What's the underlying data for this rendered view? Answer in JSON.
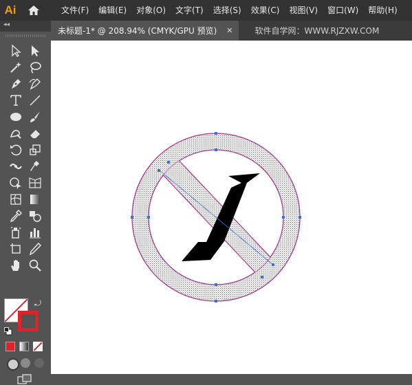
{
  "app": {
    "logo": "Ai"
  },
  "menu": [
    "文件(F)",
    "编辑(E)",
    "对象(O)",
    "文字(T)",
    "选择(S)",
    "效果(C)",
    "视图(V)",
    "窗口(W)",
    "帮助(H)"
  ],
  "tab": {
    "title": "未标题-1* @ 208.94% (CMYK/GPU 预览)",
    "close": "✕"
  },
  "watermark": "软件自学网：WWW.RJZXW.COM",
  "panel": {
    "collapse": "◂◂"
  },
  "tools": [
    [
      "selection-tool",
      "direct-selection-tool"
    ],
    [
      "magic-wand-tool",
      "lasso-tool"
    ],
    [
      "pen-tool",
      "curvature-tool"
    ],
    [
      "type-tool",
      "line-segment-tool"
    ],
    [
      "ellipse-tool",
      "paintbrush-tool"
    ],
    [
      "shaper-tool",
      "eraser-tool"
    ],
    [
      "rotate-tool",
      "scale-tool"
    ],
    [
      "width-tool",
      "puppet-warp-tool"
    ],
    [
      "shape-builder-tool",
      "perspective-grid-tool"
    ],
    [
      "mesh-tool",
      "gradient-tool"
    ],
    [
      "eyedropper-tool",
      "blend-tool"
    ],
    [
      "symbol-sprayer-tool",
      "column-graph-tool"
    ],
    [
      "artboard-tool",
      "slice-tool"
    ],
    [
      "hand-tool",
      "zoom-tool"
    ]
  ],
  "colors": {
    "stroke": "#e0222b",
    "fill": "#ffffff",
    "ring_stroke": "#a23a8f",
    "accent_anchor": "#3b6fe0",
    "app_logo": "#ff9a00"
  }
}
